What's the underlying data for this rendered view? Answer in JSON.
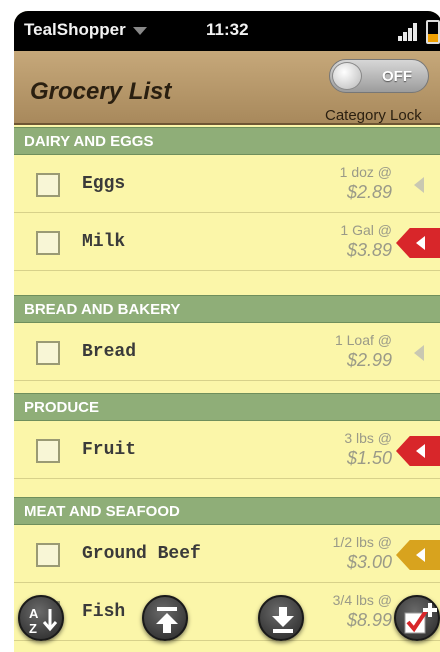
{
  "status": {
    "app_name": "TealShopper",
    "time": "11:32"
  },
  "header": {
    "title": "Grocery List",
    "toggle_state": "OFF",
    "toggle_caption": "Category Lock"
  },
  "sections": [
    {
      "label": "DAIRY AND EGGS"
    },
    {
      "label": "BREAD AND BAKERY"
    },
    {
      "label": "PRODUCE"
    },
    {
      "label": "MEAT AND SEAFOOD"
    }
  ],
  "items": [
    {
      "name": "Eggs",
      "qty": "1 doz @",
      "price": "$2.89",
      "tag": "none"
    },
    {
      "name": "Milk",
      "qty": "1 Gal @",
      "price": "$3.89",
      "tag": "red"
    },
    {
      "name": "Bread",
      "qty": "1 Loaf @",
      "price": "$2.99",
      "tag": "none"
    },
    {
      "name": "Fruit",
      "qty": "3 lbs @",
      "price": "$1.50",
      "tag": "red"
    },
    {
      "name": "Ground Beef",
      "qty": "1/2 lbs @",
      "price": "$3.00",
      "tag": "yellow"
    },
    {
      "name": "Fish",
      "qty": "3/4 lbs @",
      "price": "$8.99",
      "tag": "none"
    }
  ],
  "colors": {
    "tag_red": "#d8262a",
    "tag_yellow": "#d8a31e",
    "section_green": "#8fae78"
  },
  "commands": [
    "sort-az-icon",
    "scroll-top-icon",
    "download-icon",
    "add-check-icon"
  ]
}
